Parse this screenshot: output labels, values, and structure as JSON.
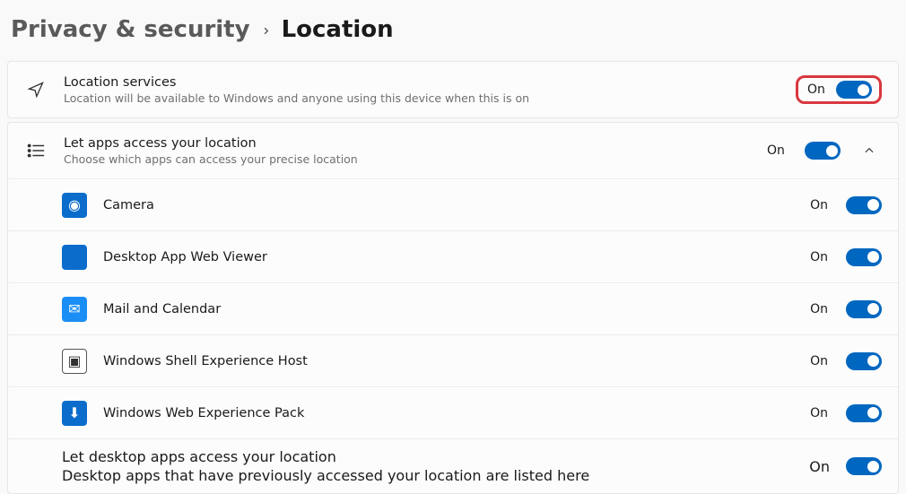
{
  "breadcrumb": {
    "parent": "Privacy & security",
    "current": "Location"
  },
  "location_services": {
    "title": "Location services",
    "sub": "Location will be available to Windows and anyone using this device when this is on",
    "state": "On"
  },
  "apps_access": {
    "title": "Let apps access your location",
    "sub": "Choose which apps can access your precise location",
    "state": "On"
  },
  "apps": [
    {
      "id": "camera",
      "label": "Camera",
      "state": "On",
      "tile": "blue",
      "glyph": "◉"
    },
    {
      "id": "webview",
      "label": "Desktop App Web Viewer",
      "state": "On",
      "tile": "blue",
      "glyph": ""
    },
    {
      "id": "mail",
      "label": "Mail and Calendar",
      "state": "On",
      "tile": "blue-light",
      "glyph": "✉"
    },
    {
      "id": "shell",
      "label": "Windows Shell Experience Host",
      "state": "On",
      "tile": "white",
      "glyph": "▣"
    },
    {
      "id": "webexp",
      "label": "Windows Web Experience Pack",
      "state": "On",
      "tile": "blue",
      "glyph": "⬇"
    }
  ],
  "desktop_apps": {
    "title": "Let desktop apps access your location",
    "sub": "Desktop apps that have previously accessed your location are listed here",
    "state": "On"
  }
}
